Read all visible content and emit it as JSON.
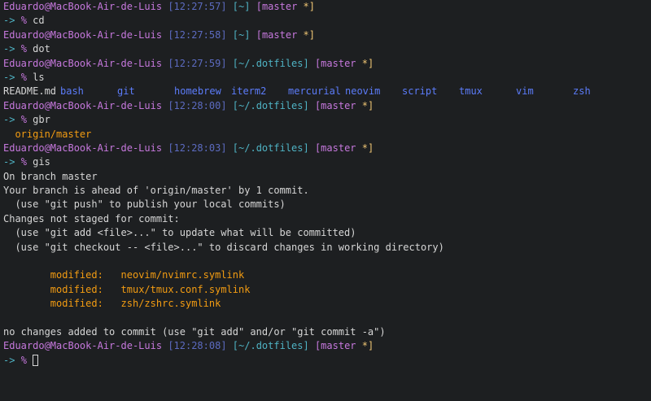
{
  "user_host": "Eduardo@MacBook-Air-de-Luis",
  "arrow": "->",
  "percent": "%",
  "colors": {
    "background": "#1d1f21",
    "user": "#c678dd",
    "time": "#5c6bc0",
    "path": "#4fb3c4",
    "branch": "#c678dd",
    "star": "#f0c674",
    "modified": "#f39c12",
    "directory": "#5c7cfa"
  },
  "prompts": [
    {
      "time": "[12:27:57]",
      "path": "[~]",
      "branch": "[master",
      "star": "*]",
      "command": "cd"
    },
    {
      "time": "[12:27:58]",
      "path": "[~]",
      "branch": "[master",
      "star": "*]",
      "command": "dot"
    },
    {
      "time": "[12:27:59]",
      "path": "[~/.dotfiles]",
      "branch": "[master",
      "star": "*]",
      "command": "ls"
    },
    {
      "time": "[12:28:00]",
      "path": "[~/.dotfiles]",
      "branch": "[master",
      "star": "*]",
      "command": "gbr"
    },
    {
      "time": "[12:28:03]",
      "path": "[~/.dotfiles]",
      "branch": "[master",
      "star": "*]",
      "command": "gis"
    },
    {
      "time": "[12:28:08]",
      "path": "[~/.dotfiles]",
      "branch": "[master",
      "star": "*]",
      "command": ""
    }
  ],
  "ls_output": {
    "file": "README.md",
    "dirs": [
      "bash",
      "git",
      "homebrew",
      "iterm2",
      "mercurial",
      "neovim",
      "script",
      "tmux",
      "vim",
      "zsh"
    ]
  },
  "gbr_output": "origin/master",
  "gis_output": {
    "line1": "On branch master",
    "line2": "Your branch is ahead of 'origin/master' by 1 commit.",
    "line3": "  (use \"git push\" to publish your local commits)",
    "line4": "Changes not staged for commit:",
    "line5": "  (use \"git add <file>...\" to update what will be committed)",
    "line6": "  (use \"git checkout -- <file>...\" to discard changes in working directory)",
    "modified": [
      {
        "label": "modified:",
        "file": "neovim/nvimrc.symlink"
      },
      {
        "label": "modified:",
        "file": "tmux/tmux.conf.symlink"
      },
      {
        "label": "modified:",
        "file": "zsh/zshrc.symlink"
      }
    ],
    "footer": "no changes added to commit (use \"git add\" and/or \"git commit -a\")"
  }
}
